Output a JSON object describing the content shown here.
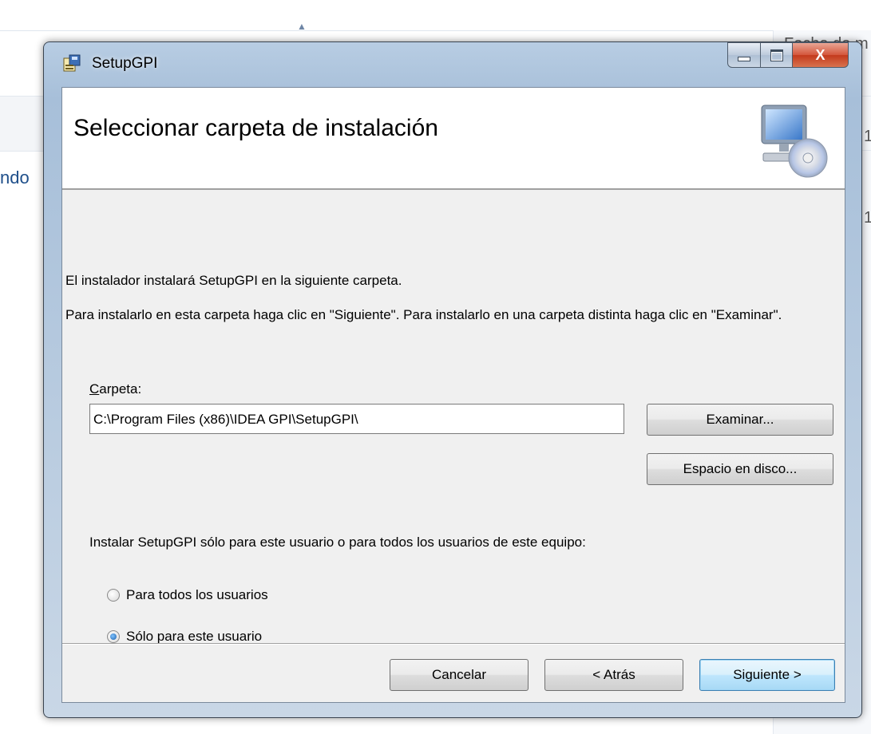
{
  "background": {
    "left_fragment": "ndo",
    "right_fragments": [
      "Fecha de m",
      "1",
      "1"
    ]
  },
  "window": {
    "title": "SetupGPI",
    "controls": {
      "minimize": "minimize",
      "maximize": "maximize",
      "close": "X"
    }
  },
  "banner": {
    "title": "Seleccionar carpeta de instalación",
    "icon": "computer-cd-icon"
  },
  "content": {
    "intro": "El instalador instalará SetupGPI en la siguiente carpeta.",
    "instructions": "Para instalarlo en esta carpeta haga clic en \"Siguiente\". Para instalarlo en una carpeta distinta haga clic en \"Examinar\".",
    "folder_label_accel": "C",
    "folder_label_rest": "arpeta:",
    "folder_value": "C:\\Program Files (x86)\\IDEA GPI\\SetupGPI\\",
    "browse_button": "Examinar...",
    "disk_space_button": "Espacio en disco...",
    "install_for_prompt": "Instalar SetupGPI sólo para este usuario o para todos los usuarios de este equipo:",
    "options": [
      {
        "label": "Para todos los usuarios",
        "checked": false
      },
      {
        "label": "Sólo para este usuario",
        "checked": true
      }
    ]
  },
  "footer": {
    "cancel": "Cancelar",
    "back": "< Atrás",
    "next": "Siguiente >"
  }
}
